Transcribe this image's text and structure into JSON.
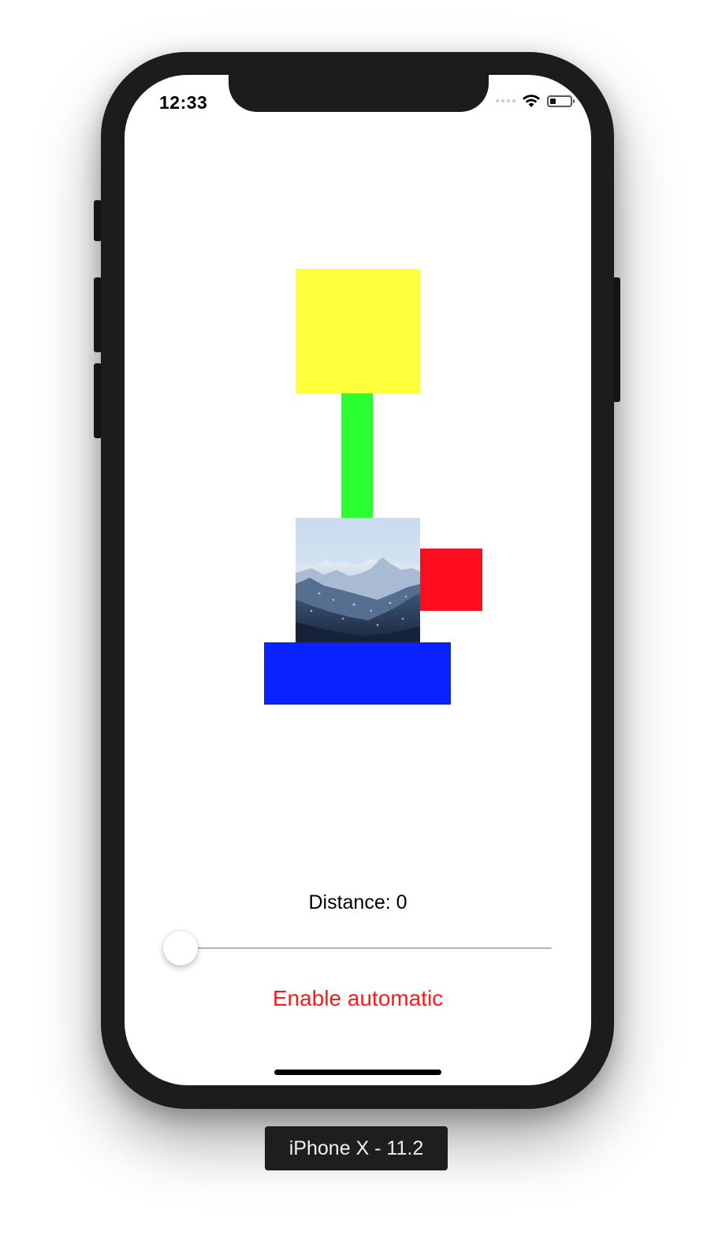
{
  "status_bar": {
    "time": "12:33",
    "battery_level": 0.25,
    "icons": [
      "signal-dots-icon",
      "wifi-icon",
      "battery-icon"
    ]
  },
  "blocks": {
    "yellow_color": "#ffff3b",
    "green_color": "#2bff31",
    "red_color": "#ff0d1f",
    "blue_color": "#0a22ff"
  },
  "distance": {
    "label": "Distance: 0"
  },
  "slider": {
    "value": 0
  },
  "button": {
    "label": "Enable automatic",
    "color": "#ff1a1a"
  },
  "device": {
    "label": "iPhone X - 11.2"
  }
}
